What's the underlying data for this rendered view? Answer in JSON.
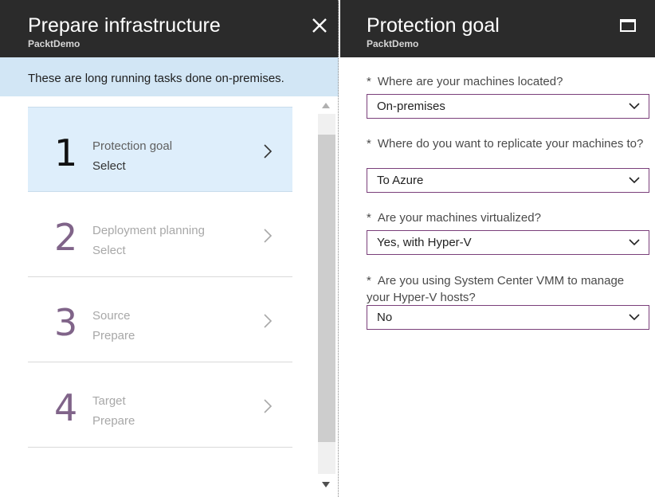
{
  "left_blade": {
    "title": "Prepare infrastructure",
    "subtitle": "PacktDemo",
    "info": "These are long running tasks done on-premises.",
    "steps": [
      {
        "number": "1",
        "title": "Protection goal",
        "status": "Select",
        "active": true
      },
      {
        "number": "2",
        "title": "Deployment planning",
        "status": "Select",
        "active": false
      },
      {
        "number": "3",
        "title": "Source",
        "status": "Prepare",
        "active": false
      },
      {
        "number": "4",
        "title": "Target",
        "status": "Prepare",
        "active": false
      }
    ]
  },
  "right_blade": {
    "title": "Protection goal",
    "subtitle": "PacktDemo",
    "required_marker": "*",
    "fields": [
      {
        "label": "Where are your machines located?",
        "value": "On-premises"
      },
      {
        "label": "Where do you want to replicate your machines to?",
        "value": "To Azure"
      },
      {
        "label": "Are your machines virtualized?",
        "value": "Yes, with Hyper-V"
      },
      {
        "label": "Are you using System Center VMM to manage your Hyper-V hosts?",
        "value": "No"
      }
    ]
  },
  "colors": {
    "header_bg": "#2b2b2b",
    "info_bg": "#d2e6f5",
    "active_step_bg": "#deeefb",
    "select_border": "#7a3f7a"
  },
  "icons": {
    "close": "close-icon",
    "maximize": "maximize-icon",
    "chevron_right": "chevron-right-icon",
    "chevron_down": "chevron-down-icon"
  }
}
